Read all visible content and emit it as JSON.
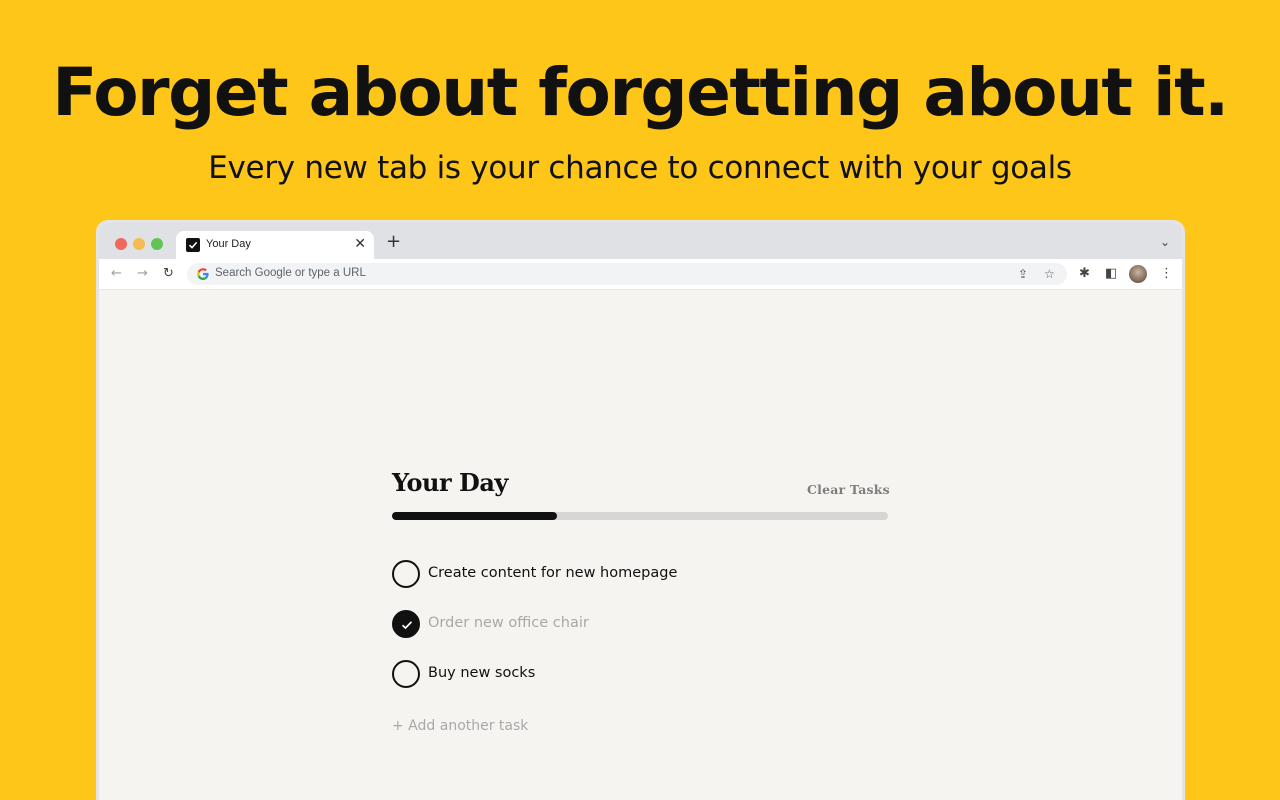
{
  "hero": {
    "headline": "Forget about forgetting about it.",
    "subheadline": "Every new tab is your chance to connect with your goals"
  },
  "browser": {
    "tab": {
      "title": "Your Day",
      "close": "✕"
    },
    "new_tab": "+",
    "tab_menu": "⌄",
    "omnibox": {
      "placeholder": "Search Google or type a URL"
    },
    "nav": {
      "back": "←",
      "forward": "→",
      "reload": "↻"
    },
    "toolbar_icons": [
      "share-icon",
      "star-icon",
      "extensions-icon",
      "side-panel-icon",
      "profile-avatar",
      "menu-icon"
    ],
    "icon_glyphs": {
      "share": "⇪",
      "star": "☆",
      "extensions": "✱",
      "side_panel": "◧",
      "menu": "⋮"
    }
  },
  "app": {
    "title": "Your Day",
    "clear_label": "Clear Tasks",
    "progress": 0.333,
    "tasks": [
      {
        "label": "Create content for new homepage",
        "done": false
      },
      {
        "label": "Order new office chair",
        "done": true
      },
      {
        "label": "Buy new socks",
        "done": false
      }
    ],
    "add_label": "+ Add another task"
  },
  "colors": {
    "background": "#ffc61a",
    "page": "#f5f4f1",
    "accent": "#111111",
    "muted": "#a8a8a8"
  }
}
